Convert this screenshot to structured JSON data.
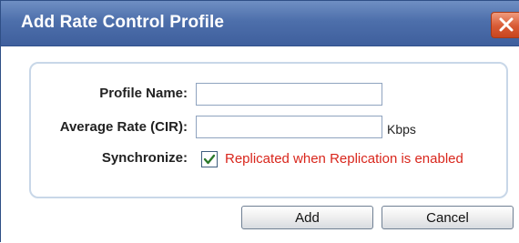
{
  "dialog": {
    "title": "Add Rate Control Profile",
    "close_icon": "close-x-icon"
  },
  "form": {
    "profile_name_label": "Profile Name:",
    "profile_name_value": "",
    "average_rate_label": "Average Rate (CIR):",
    "average_rate_value": "",
    "average_rate_unit": "Kbps",
    "synchronize_label": "Synchronize:",
    "synchronize_checked": true,
    "synchronize_note": "Replicated when Replication is enabled"
  },
  "buttons": {
    "add_label": "Add",
    "cancel_label": "Cancel"
  },
  "colors": {
    "titlebar": "#4d6fab",
    "note": "#d9261c",
    "close_button": "#d85a34"
  }
}
